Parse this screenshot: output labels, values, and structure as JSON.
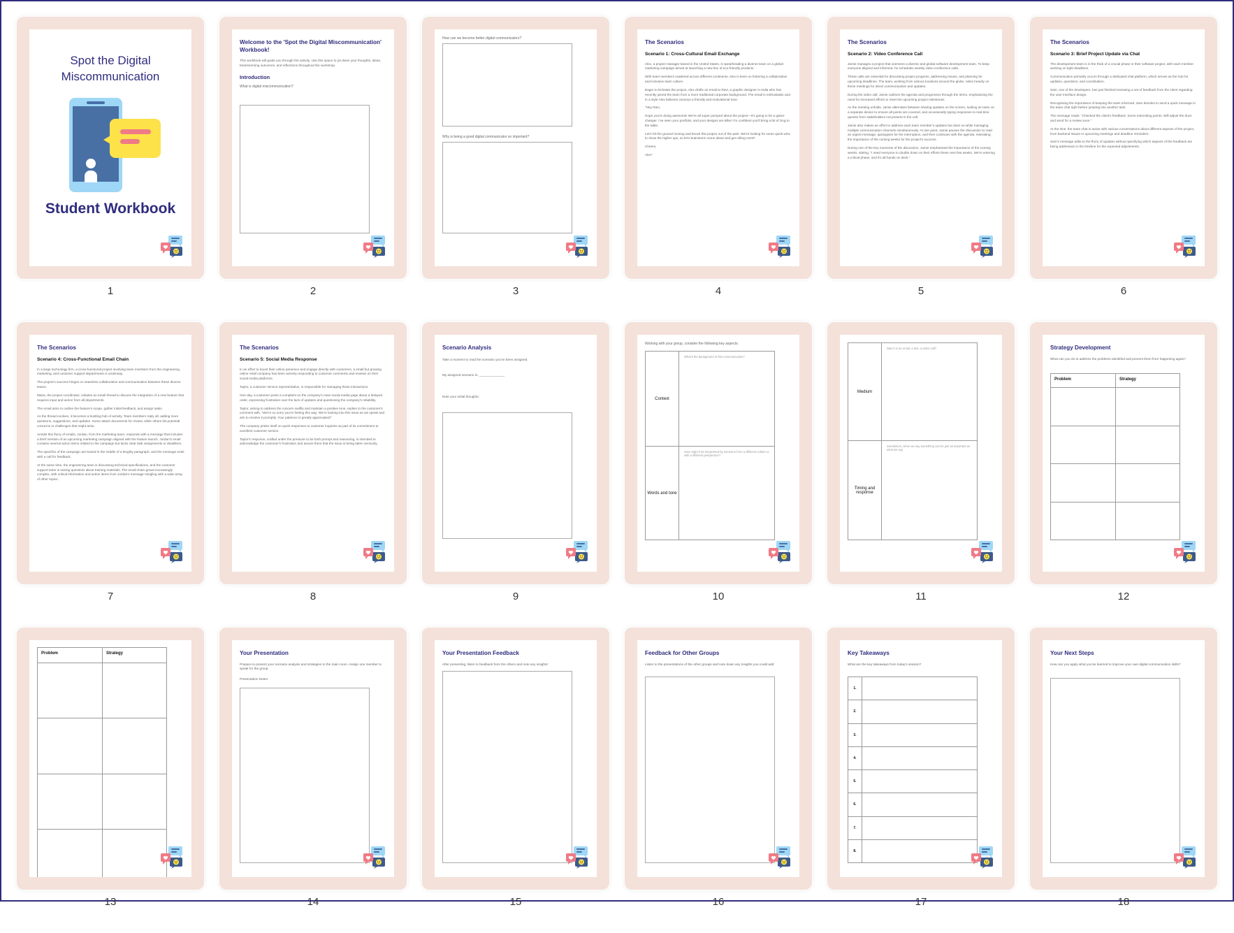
{
  "pages": [
    {
      "number": "1",
      "title": "Spot the Digital Miscommunication",
      "subtitle": "Student Workbook"
    },
    {
      "number": "2",
      "heading": "Welcome to the 'Spot the Digital Miscommunication' Workbook!",
      "intro": "This workbook will guide you through the activity. Use this space to jot down your thoughts, ideas, brainstorming outcomes, and reflections throughout the workshop.",
      "section": "Introduction",
      "question": "What is digital miscommunication?"
    },
    {
      "number": "3",
      "q1": "How can we become better digital communicators?",
      "q2": "Why is being a good digital communicator so important?"
    },
    {
      "number": "4",
      "heading": "The Scenarios",
      "scenario": "Scenario 1: Cross-Cultural Email Exchange",
      "paragraphs": [
        "Alex, a project manager based in the United States, is spearheading a diverse team on a global marketing campaign aimed at launching a new line of eco-friendly products.",
        "With team members scattered across different continents, Alex is keen on fostering a collaborative and inclusive team culture.",
        "Eager to kickstart the project, Alex drafts an email to Ravi, a graphic designer in India who has recently joined the team from a more traditional corporate background. The email is enthusiastic and in a style Alex believes conveys a friendly and motivational tone.",
        "\"Hey Ravi,",
        "Hope you're doing awesome! We're all super pumped about the project—it's going to be a game-changer. I've seen your portfolio, and your designs are killer! I'm confident you'll bring a bit of zing to the table.",
        "Let's hit the ground running and knock this project out of the park. We're looking for some quick wins to show the higher ups, so let's brainstorm some ideas and get rolling ASAP.",
        "Cheers,",
        "Alex\""
      ]
    },
    {
      "number": "5",
      "heading": "The Scenarios",
      "scenario": "Scenario 2: Video Conference Call",
      "paragraphs": [
        "Jamie manages a project that oversees a diverse and global software development team. To keep everyone aligned and informed, he schedules weekly video conference calls.",
        "These calls are essential for discussing project progress, addressing issues, and planning for upcoming deadlines. The team, working from various locations around the globe, relies heavily on these meetings for direct communication and updates.",
        "During the video call, Jamie outlines the agenda and progresses through the items, emphasising the need for increased efforts to meet the upcoming project milestones.",
        "As the meeting unfolds, Jamie alternates between sharing updates on the screen, looking at notes on a separate device to ensure all points are covered, and occasionally typing responses to real-time queries from stakeholders not present in the call.",
        "Jamie also makes an effort to address each team member's updates but does so while managing multiple communication channels simultaneously. At one point, Jamie pauses the discussion to read an urgent message, apologises for the interruption, and then continues with the agenda, reiterating the importance of the coming weeks for the project's success.",
        "During one of the key moments of the discussion, Jamie emphasised the importance of the coming weeks, stating, \"I need everyone to double down on their efforts these next few weeks. We're entering a critical phase, and it's all hands on deck.\""
      ]
    },
    {
      "number": "6",
      "heading": "The Scenarios",
      "scenario": "Scenario 3: Brief Project Update via Chat",
      "paragraphs": [
        "The development team is in the thick of a crucial phase in their software project, with each member working on tight deadlines.",
        "Communication primarily occurs through a dedicated chat platform, which serves as the hub for updates, questions, and coordination.",
        "Sam, one of the developers, has just finished reviewing a set of feedback from the client regarding the user interface design.",
        "Recognising the importance of keeping the team informed, Sam decides to send a quick message in the team chat right before jumping into another task.",
        "The message reads: \"Checked the client's feedback. Some interesting points. Will adjust the docs and send for a review soon.\"",
        "At the time, the team chat is active with various conversations about different aspects of the project, from backend issues to upcoming meetings and deadline reminders.",
        "Sam's message adds to the flurry of updates without specifying which aspects of the feedback are being addressed or the timeline for the expected adjustments."
      ]
    },
    {
      "number": "7",
      "heading": "The Scenarios",
      "scenario": "Scenario 4: Cross-Functional Email Chain",
      "paragraphs": [
        "In a large technology firm, a cross-functional project involving team members from the engineering, marketing, and customer support departments is underway.",
        "The project's success hinges on seamless collaboration and communication between these diverse teams.",
        "Maria, the project coordinator, initiates an email thread to discuss the integration of a new feature that requires input and action from all departments.",
        "The email aims to outline the feature's scope, gather initial feedback, and assign tasks.",
        "As the thread evolves, it becomes a bustling hub of activity. Team members reply all, adding more questions, suggestions, and updates. Some attach documents for review, while others list potential concerns or challenges that might arise.",
        "Amidst this flurry of emails, Jordan, from the marketing team, responds with a message that includes a brief mention of an upcoming marketing campaign aligned with the feature launch. Jordan's email contains several action items related to the campaign but lacks clear task assignments or deadlines.",
        "The specifics of the campaign are buried in the middle of a lengthy paragraph, and the message ends with a call for feedback.",
        "At the same time, the engineering team is discussing technical specifications, and the customer support team is raising questions about training materials. The email chain grows increasingly complex, with critical information and action items from Jordan's message mingling with a wide array of other topics."
      ]
    },
    {
      "number": "8",
      "heading": "The Scenarios",
      "scenario": "Scenario 5: Social Media Response",
      "paragraphs": [
        "In an effort to boost their online presence and engage directly with customers, a small but growing online retail company has been actively responding to customer comments and reviews on their social media platforms.",
        "Taylor, a customer service representative, is responsible for managing these interactions.",
        "One day, a customer posts a complaint on the company's main social media page about a delayed order, expressing frustration over the lack of updates and questioning the company's reliability.",
        "Taylor, aiming to address the concern swiftly and maintain a positive tone, replies to the customer's comment with, \"We're so sorry you're feeling this way. We're looking into this issue as we speak and aim to resolve it promptly. Your patience is greatly appreciated!\"",
        "The company prides itself on quick responses to customer inquiries as part of its commitment to excellent customer service.",
        "Taylor's response, crafted under the pressure to be both prompt and reassuring, is intended to acknowledge the customer's frustration and assure them that the issue is being taken seriously."
      ]
    },
    {
      "number": "9",
      "heading": "Scenario Analysis",
      "p1": "Take a moment to read the scenario you've been assigned.",
      "p2": "My assigned scenario is: ______________",
      "p3": "Note your initial thoughts:"
    },
    {
      "number": "10",
      "intro": "Working with your group, consider the following key aspects:",
      "rows": [
        {
          "label": "Context",
          "prompt": "What's the background of this communication?"
        },
        {
          "label": "Words and tone",
          "prompt": "How might it be interpreted by someone from a different culture or with a different perspective?"
        }
      ]
    },
    {
      "number": "11",
      "rows": [
        {
          "label": "Medium",
          "prompt": "Was it in an email, a text, a video call?"
        },
        {
          "label": "Timing and response",
          "prompt": "Sometimes, when we say something can be just as important as what we say."
        }
      ]
    },
    {
      "number": "12",
      "heading": "Strategy Development",
      "intro": "What can you do to address the problems identified and prevent them from happening again?",
      "col1": "Problem",
      "col2": "Strategy"
    },
    {
      "number": "13",
      "col1": "Problem",
      "col2": "Strategy"
    },
    {
      "number": "14",
      "heading": "Your Presentation",
      "intro": "Prepare to present your scenario analysis and strategies to the main room. Assign one member to speak for the group.",
      "notes": "Presentation Notes:"
    },
    {
      "number": "15",
      "heading": "Your Presentation Feedback",
      "intro": "After presenting, listen to feedback from the others and note any insights:"
    },
    {
      "number": "16",
      "heading": "Feedback for Other Groups",
      "intro": "Listen to the presentations of the other groups and note down any insights you could add:"
    },
    {
      "number": "17",
      "heading": "Key Takeaways",
      "intro": "What are the key takeaways from today's session?",
      "items": [
        "1.",
        "2.",
        "3.",
        "4.",
        "5.",
        "6.",
        "7.",
        "8."
      ]
    },
    {
      "number": "18",
      "heading": "Your Next Steps",
      "intro": "How can you apply what you've learned to improve your own digital communication skills?"
    }
  ],
  "colors": {
    "frame": "#f4e1d9",
    "accent": "#2f2d7e",
    "border": "#2f2d7e"
  },
  "icons": {
    "logo": "chat-bubbles-heart-smiley-icon"
  }
}
